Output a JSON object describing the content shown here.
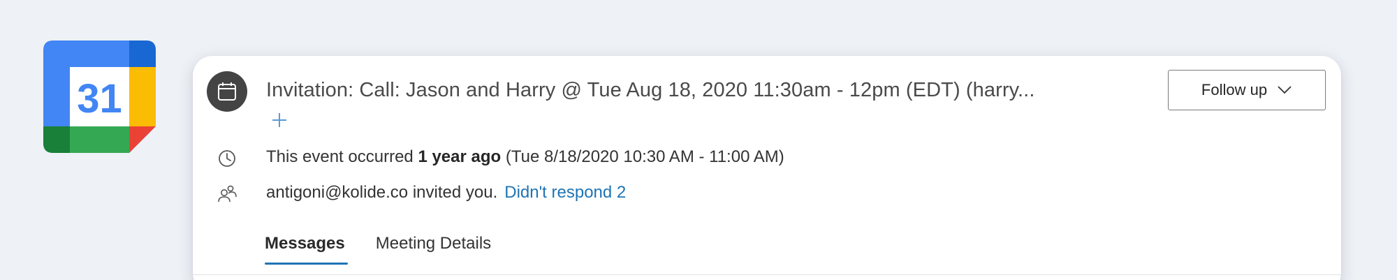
{
  "logo": {
    "day_number": "31",
    "icon": "google-calendar-icon"
  },
  "event": {
    "icon": "calendar-icon",
    "subject": "Invitation: Call: Jason and Harry @ Tue Aug 18, 2020 11:30am - 12pm (EDT) (harry...",
    "add_icon": "plus-icon"
  },
  "follow_up": {
    "label": "Follow up",
    "icon": "chevron-down-icon"
  },
  "occurrence": {
    "icon": "clock-icon",
    "prefix": "This event occurred ",
    "relative": "1 year ago",
    "range": " (Tue 8/18/2020 10:30 AM - 11:00 AM)"
  },
  "invite": {
    "icon": "attendees-icon",
    "text": "antigoni@kolide.co invited you.",
    "link": "Didn't respond 2"
  },
  "tabs": [
    {
      "label": "Messages",
      "active": true
    },
    {
      "label": "Meeting Details",
      "active": false
    }
  ],
  "colors": {
    "accent": "#1f74b4",
    "gcal_blue": "#4285f4",
    "gcal_dark_blue": "#1967d2",
    "gcal_yellow": "#fbbc04",
    "gcal_green": "#34a853",
    "gcal_dark_green": "#188038",
    "gcal_red": "#ea4335"
  }
}
